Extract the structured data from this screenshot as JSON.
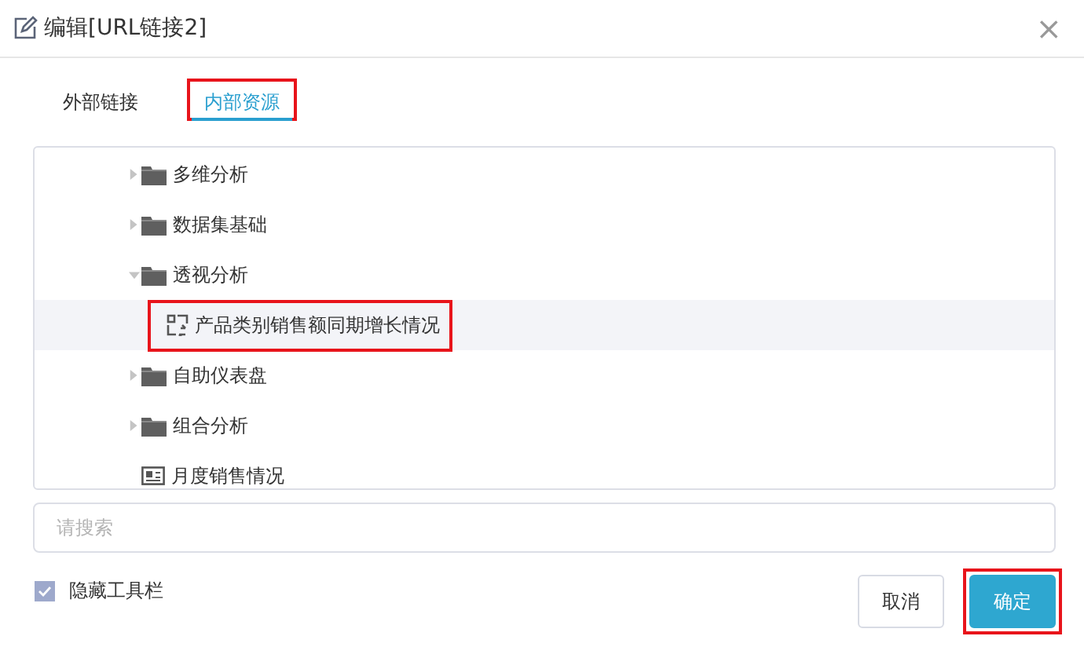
{
  "window": {
    "title": "编辑[URL链接2]",
    "close": "×"
  },
  "tabs": [
    {
      "label": "外部链接",
      "selected": false,
      "highlighted": false
    },
    {
      "label": "内部资源",
      "selected": true,
      "highlighted": true
    }
  ],
  "tree": [
    {
      "kind": "folder",
      "label": "多维分析",
      "expanded": false
    },
    {
      "kind": "folder",
      "label": "数据集基础",
      "expanded": false
    },
    {
      "kind": "folder",
      "label": "透视分析",
      "expanded": true,
      "children": [
        {
          "kind": "pivot",
          "label": "产品类别销售额同期增长情况",
          "selected": true,
          "highlighted": true
        }
      ]
    },
    {
      "kind": "folder",
      "label": "自助仪表盘",
      "expanded": false
    },
    {
      "kind": "folder",
      "label": "组合分析",
      "expanded": false
    },
    {
      "kind": "report",
      "label": "月度销售情况",
      "selected": false
    }
  ],
  "search": {
    "placeholder": "请搜索"
  },
  "hide_toolbar": {
    "label": "隐藏工具栏",
    "checked": true
  },
  "buttons": [
    {
      "label": "取消",
      "kind": "secondary",
      "highlighted": false
    },
    {
      "label": "确定",
      "kind": "primary",
      "highlighted": true
    }
  ]
}
